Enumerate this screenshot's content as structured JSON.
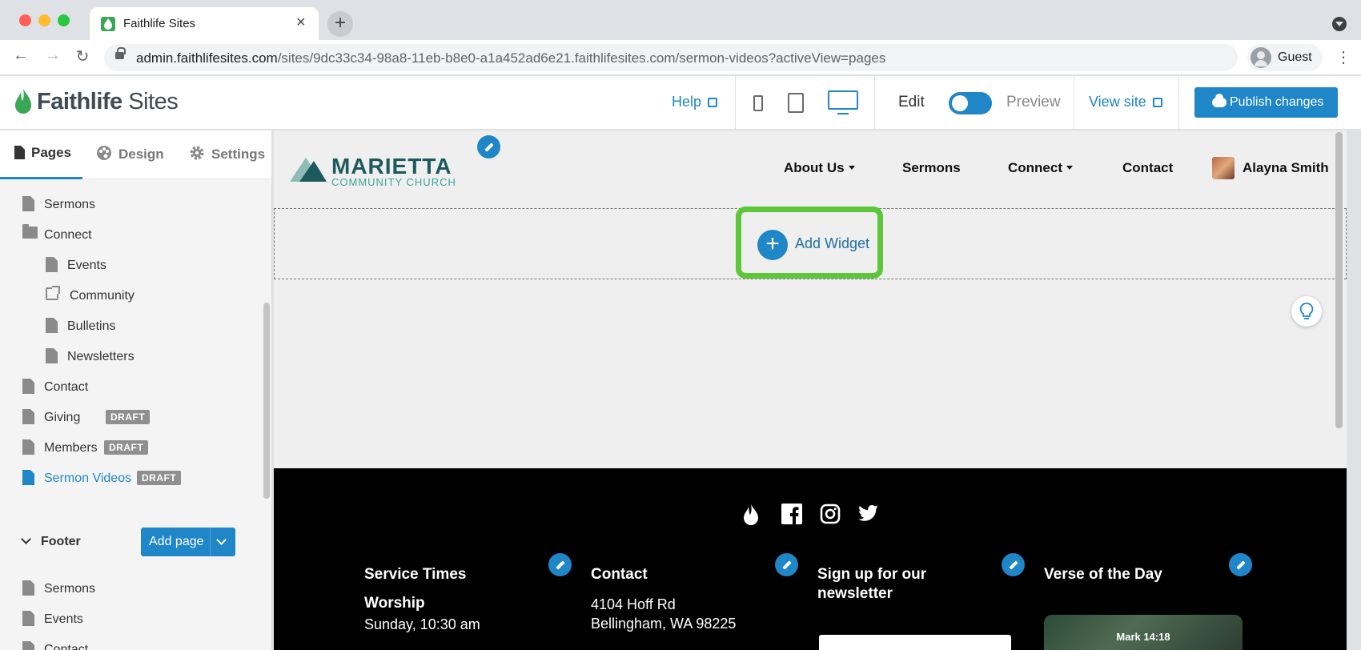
{
  "browser": {
    "tab_title": "Faithlife Sites",
    "url_host": "admin.faithlifesites.com",
    "url_path": "/sites/9dc33c34-98a8-11eb-b8e0-a1a452ad6e21.faithlifesites.com/sermon-videos?activeView=pages",
    "profile_label": "Guest",
    "new_tab_symbol": "+",
    "close_symbol": "×",
    "back_symbol": "←",
    "forward_symbol": "→",
    "reload_symbol": "↻",
    "menu_symbol": "⋮"
  },
  "header": {
    "logo_bold": "Faithlife",
    "logo_light": " Sites",
    "help_label": "Help",
    "edit_label": "Edit",
    "preview_label": "Preview",
    "view_site_label": "View site",
    "publish_label": "Publish changes",
    "mode": "edit",
    "active_device": "desktop"
  },
  "sidebar": {
    "tabs": [
      {
        "label": "Pages",
        "icon": "page-icon",
        "active": true
      },
      {
        "label": "Design",
        "icon": "palette-icon",
        "active": false
      },
      {
        "label": "Settings",
        "icon": "gear-icon",
        "active": false
      }
    ],
    "pages": [
      {
        "label": "Sermons",
        "icon": "page-icon",
        "indent": 0
      },
      {
        "label": "Connect",
        "icon": "folder-icon",
        "indent": 0
      },
      {
        "label": "Events",
        "icon": "page-icon",
        "indent": 1
      },
      {
        "label": "Community",
        "icon": "external-link-icon",
        "indent": 1
      },
      {
        "label": "Bulletins",
        "icon": "page-icon",
        "indent": 1
      },
      {
        "label": "Newsletters",
        "icon": "page-icon",
        "indent": 1
      },
      {
        "label": "Contact",
        "icon": "page-icon",
        "indent": 0
      },
      {
        "label": "Giving",
        "icon": "page-icon",
        "indent": 0,
        "badge": "DRAFT"
      },
      {
        "label": "Members",
        "icon": "page-icon",
        "indent": 0,
        "badge": "DRAFT"
      },
      {
        "label": "Sermon Videos",
        "icon": "page-icon",
        "indent": 0,
        "badge": "DRAFT",
        "active": true
      }
    ],
    "footer_section_label": "Footer",
    "add_page_label": "Add page",
    "footer_pages": [
      {
        "label": "Sermons",
        "icon": "page-icon"
      },
      {
        "label": "Events",
        "icon": "page-icon"
      },
      {
        "label": "Contact",
        "icon": "page-icon"
      }
    ]
  },
  "site": {
    "church_name": "MARIETTA",
    "church_subtitle": "COMMUNITY CHURCH",
    "nav": [
      {
        "label": "About Us",
        "dropdown": true
      },
      {
        "label": "Sermons",
        "dropdown": false
      },
      {
        "label": "Connect",
        "dropdown": true
      },
      {
        "label": "Contact",
        "dropdown": false
      }
    ],
    "user_name": "Alayna Smith",
    "add_widget_label": "Add Widget",
    "footer": {
      "social_icons": [
        "faithlife-icon",
        "facebook-icon",
        "instagram-icon",
        "twitter-icon"
      ],
      "service_times_title": "Service Times",
      "worship_label": "Worship",
      "worship_time": "Sunday, 10:30 am",
      "contact_title": "Contact",
      "address_line1": "4104 Hoff Rd",
      "address_line2": "Bellingham, WA 98225",
      "newsletter_title_line1": "Sign up for our",
      "newsletter_title_line2": "newsletter",
      "verse_title": "Verse of the Day",
      "verse_reference": "Mark 14:18"
    }
  },
  "colors": {
    "accent": "#1f86c8",
    "highlight": "#5ec63a",
    "church_teal": "#1c5a5e",
    "draft_badge": "#8f8f8f"
  }
}
